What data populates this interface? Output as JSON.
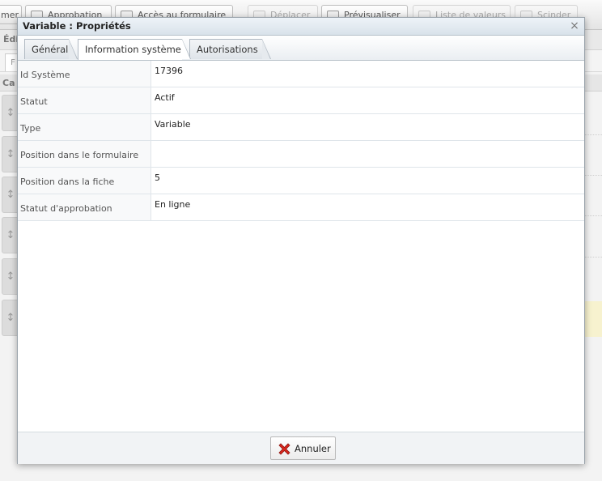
{
  "background": {
    "toolbar": {
      "buttons": [
        "mer",
        "Approbation",
        "Accès au formulaire",
        "Déplacer",
        "Prévisualiser",
        "Liste de valeurs",
        "Scinder"
      ]
    },
    "subbar_label": "Édi",
    "tab_label": "F",
    "column_header": "Ca"
  },
  "dialog": {
    "title": "Variable : Propriétés",
    "close_label": "×",
    "tabs": [
      {
        "label": "Général",
        "active": false
      },
      {
        "label": "Information système",
        "active": true
      },
      {
        "label": "Autorisations",
        "active": false
      }
    ],
    "properties": [
      {
        "label": "Id Système",
        "value": "17396"
      },
      {
        "label": "Statut",
        "value": "Actif"
      },
      {
        "label": "Type",
        "value": "Variable"
      },
      {
        "label": "Position dans le formulaire",
        "value": ""
      },
      {
        "label": "Position dans la fiche",
        "value": "5"
      },
      {
        "label": "Statut d'approbation",
        "value": "En ligne"
      }
    ],
    "cancel_button": {
      "label": "Annuler",
      "icon": "red-x-icon"
    }
  },
  "colors": {
    "cancel_icon": "#d9261c",
    "title_bar": "#dfe6ed",
    "row_border": "#dfe5ea"
  }
}
